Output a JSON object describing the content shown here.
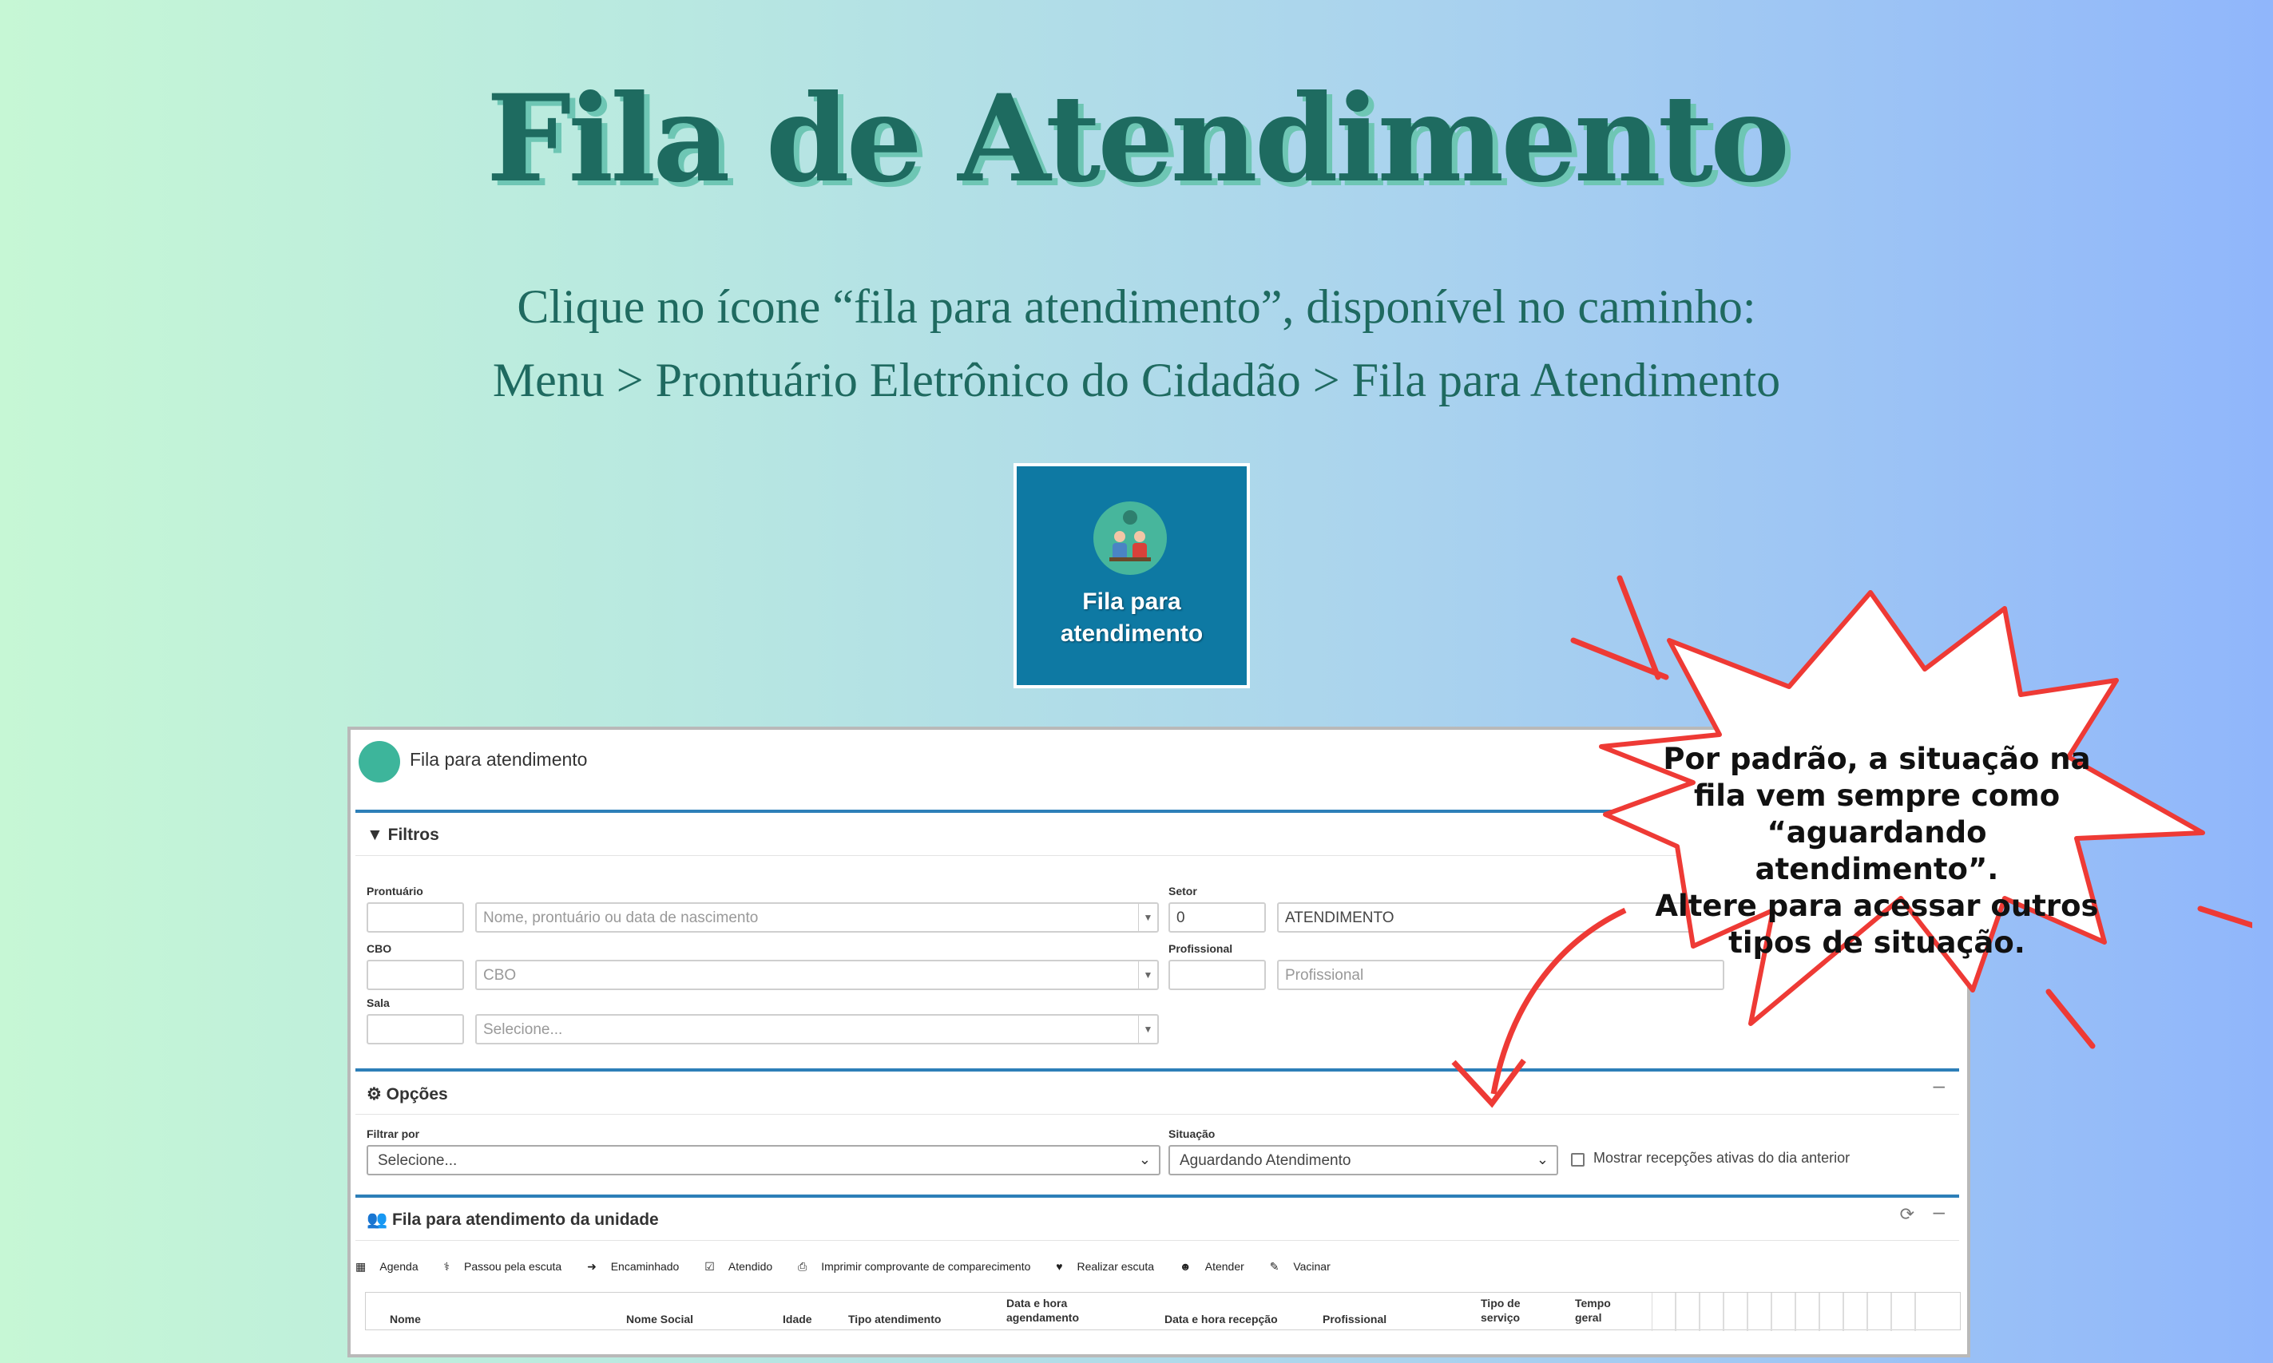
{
  "title": "Fila de Atendimento",
  "subtitle_line1": "Clique no ícone “fila para atendimento”, disponível no caminho:",
  "subtitle_line2": "Menu > Prontuário Eletrônico do Cidadão > Fila para Atendimento",
  "app_icon": {
    "label_line1": "Fila para",
    "label_line2": "atendimento",
    "icon": "queue-people-icon"
  },
  "callout": {
    "line1": "Por padrão, a situação na",
    "line2": "fila vem sempre como",
    "line3": "“aguardando atendimento”.",
    "line4": "Altere para acessar outros",
    "line5": "tipos de situação."
  },
  "window": {
    "title": "Fila para atendimento",
    "filters": {
      "heading": "Filtros",
      "prontuario_label": "Prontuário",
      "prontuario_search_placeholder": "Nome, prontuário ou data de nascimento",
      "setor_label": "Setor",
      "setor_code": "0",
      "setor_name": "ATENDIMENTO",
      "cbo_label": "CBO",
      "cbo_placeholder": "CBO",
      "profissional_label": "Profissional",
      "profissional_placeholder": "Profissional",
      "sala_label": "Sala",
      "sala_placeholder": "Selecione..."
    },
    "options": {
      "heading": "Opções",
      "filtrar_label": "Filtrar por",
      "filtrar_value": "Selecione...",
      "situacao_label": "Situação",
      "situacao_value": "Aguardando Atendimento",
      "checkbox_label": "Mostrar recepções ativas do dia anterior"
    },
    "queue": {
      "heading": "Fila para atendimento da unidade",
      "toolbar": [
        "Agenda",
        "Passou pela escuta",
        "Encaminhado",
        "Atendido",
        "Imprimir comprovante de comparecimento",
        "Realizar escuta",
        "Atender",
        "Vacinar"
      ],
      "columns": {
        "nome": "Nome",
        "nome_social": "Nome Social",
        "idade": "Idade",
        "tipo_atendimento": "Tipo atendimento",
        "data_agendamento_1": "Data e hora",
        "data_agendamento_2": "agendamento",
        "data_recepcao": "Data e hora recepção",
        "profissional": "Profissional",
        "tipo_servico_1": "Tipo de",
        "tipo_servico_2": "serviço",
        "tempo_geral_1": "Tempo",
        "tempo_geral_2": "geral"
      }
    }
  },
  "colors": {
    "title": "#1e6b60",
    "panel_accent": "#2d7fb8",
    "callout_border": "#ee3a35",
    "icon_tile": "#0e79a3"
  }
}
